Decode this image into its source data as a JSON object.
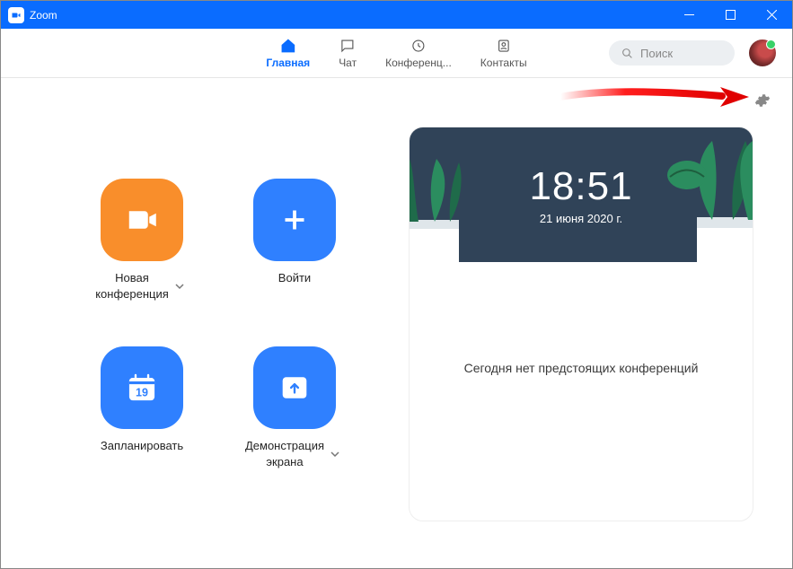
{
  "titlebar": {
    "title": "Zoom"
  },
  "tabs": {
    "home": {
      "label": "Главная"
    },
    "chat": {
      "label": "Чат"
    },
    "meetings": {
      "label": "Конференц..."
    },
    "contacts": {
      "label": "Контакты"
    }
  },
  "search": {
    "placeholder": "Поиск"
  },
  "actions": {
    "new_meeting": {
      "label": "Новая\nконференция"
    },
    "join": {
      "label": "Войти"
    },
    "schedule": {
      "label": "Запланировать",
      "day": "19"
    },
    "share_screen": {
      "label": "Демонстрация\nэкрана"
    }
  },
  "clock": {
    "time": "18:51",
    "date": "21 июня 2020 г."
  },
  "panel": {
    "no_meetings": "Сегодня нет предстоящих конференций"
  }
}
